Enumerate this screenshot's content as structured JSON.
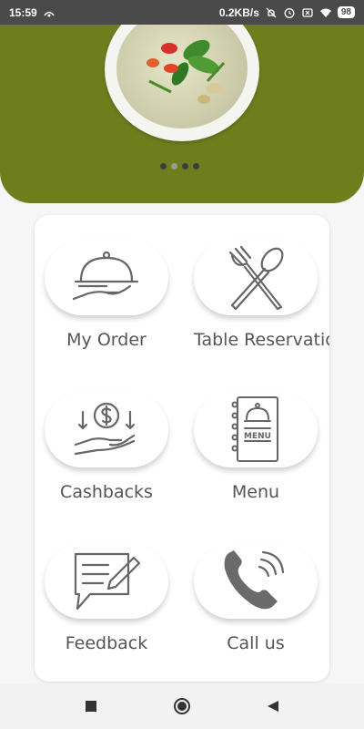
{
  "status_bar": {
    "time": "15:59",
    "network_speed": "0.2KB/s",
    "battery": "98",
    "icons": [
      "signal-icon",
      "mute-icon",
      "alarm-icon",
      "sim-icon",
      "wifi-icon",
      "battery-icon"
    ]
  },
  "hero": {
    "carousel_pages": 4,
    "active_page": 2,
    "background_color": "#6f7e1d"
  },
  "menu_tiles": [
    {
      "label": "My Order",
      "icon": "cloche-hand-icon"
    },
    {
      "label": "Table Reservatio",
      "icon": "fork-spoon-icon"
    },
    {
      "label": "Cashbacks",
      "icon": "coin-hand-icon"
    },
    {
      "label": "Menu",
      "icon": "menu-book-icon"
    },
    {
      "label": "Feedback",
      "icon": "feedback-note-icon"
    },
    {
      "label": "Call us",
      "icon": "phone-icon"
    }
  ],
  "nav_bar": {
    "buttons": [
      "recent-apps-icon",
      "home-icon",
      "back-icon"
    ]
  }
}
